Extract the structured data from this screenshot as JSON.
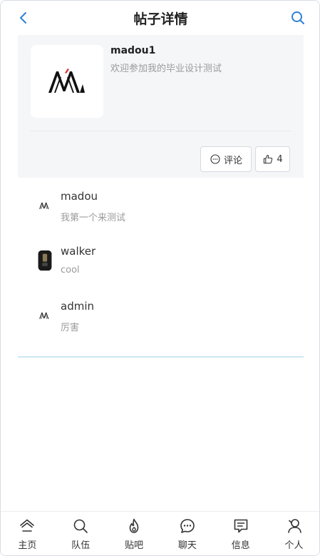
{
  "header": {
    "title": "帖子详情",
    "back_icon": "chevron-left-icon",
    "search_icon": "search-icon",
    "accent": "#2f7fd6"
  },
  "post": {
    "author": "madou1",
    "content": "欢迎参加我的毕业设计测试",
    "logo_icon": "aa-logo",
    "comment_label": "评论",
    "comment_icon": "chat-bubble-icon",
    "like_count": "4",
    "like_icon": "thumbs-up-icon"
  },
  "comments": [
    {
      "name": "madou",
      "text": "我第一个来测试",
      "avatar": "aa-logo-avatar"
    },
    {
      "name": "walker",
      "text": "cool",
      "avatar": "walker-avatar"
    },
    {
      "name": "admin",
      "text": "厉害",
      "avatar": "aa-logo-avatar"
    }
  ],
  "nav": [
    {
      "label": "主页",
      "icon": "home-icon"
    },
    {
      "label": "队伍",
      "icon": "search-icon"
    },
    {
      "label": "贴吧",
      "icon": "flame-icon"
    },
    {
      "label": "聊天",
      "icon": "chat-icon"
    },
    {
      "label": "信息",
      "icon": "message-icon"
    },
    {
      "label": "个人",
      "icon": "person-icon"
    }
  ]
}
